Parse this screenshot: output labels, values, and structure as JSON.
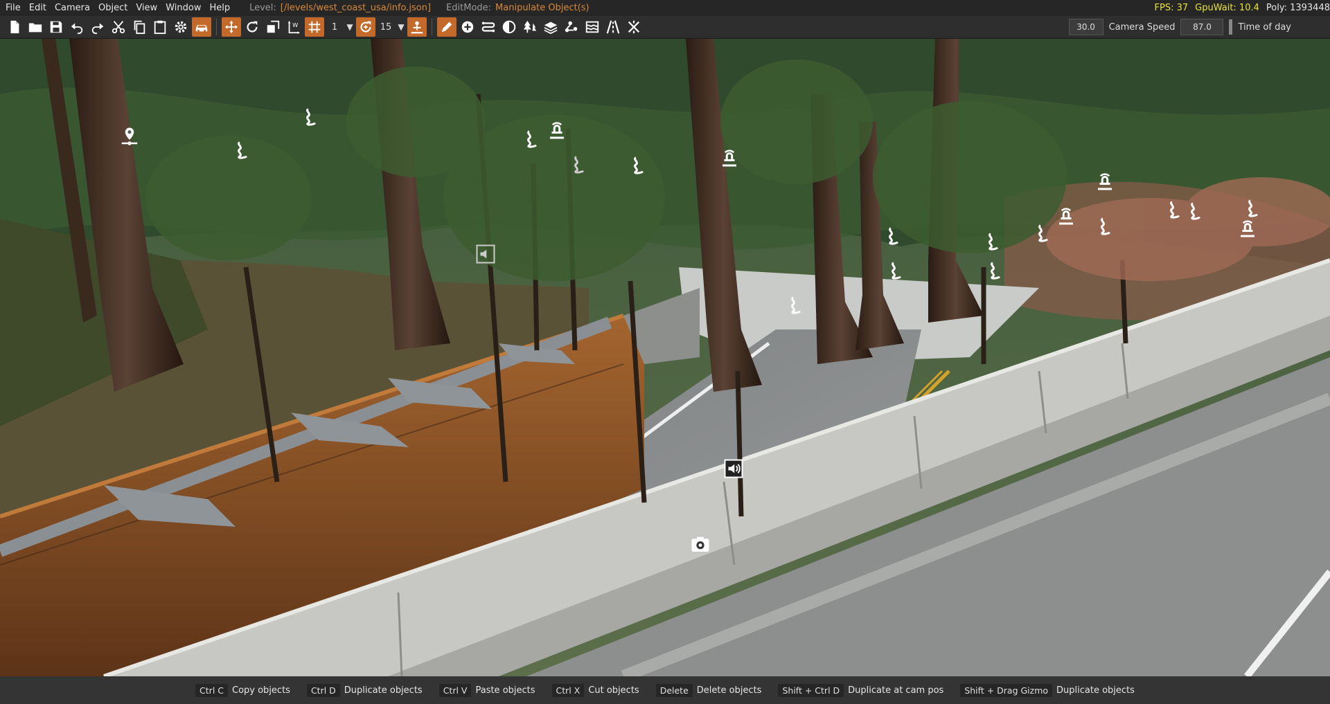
{
  "menubar": {
    "items": [
      "File",
      "Edit",
      "Camera",
      "Object",
      "View",
      "Window",
      "Help"
    ],
    "level_label": "Level:",
    "level_value": "[/levels/west_coast_usa/info.json]",
    "editmode_label": "EditMode:",
    "editmode_value": "Manipulate Object(s)",
    "fps": "FPS: 37",
    "gpuwait": "GpuWait: 10.4",
    "poly": "Poly: 1393448"
  },
  "toolbar": {
    "snap_value": "1",
    "rotate_snap_value": "15",
    "camera_speed_value": "30.0",
    "camera_speed_label": "Camera Speed",
    "time_of_day_value": "87.0",
    "time_of_day_label": "Time of day",
    "accent_color": "#c36a2a"
  },
  "shortcuts": [
    {
      "key": "Ctrl C",
      "desc": "Copy objects"
    },
    {
      "key": "Ctrl D",
      "desc": "Duplicate objects"
    },
    {
      "key": "Ctrl V",
      "desc": "Paste objects"
    },
    {
      "key": "Ctrl X",
      "desc": "Cut objects"
    },
    {
      "key": "Delete",
      "desc": "Delete objects"
    },
    {
      "key": "Shift + Ctrl D",
      "desc": "Duplicate at cam pos"
    },
    {
      "key": "Shift + Drag Gizmo",
      "desc": "Duplicate objects"
    }
  ]
}
